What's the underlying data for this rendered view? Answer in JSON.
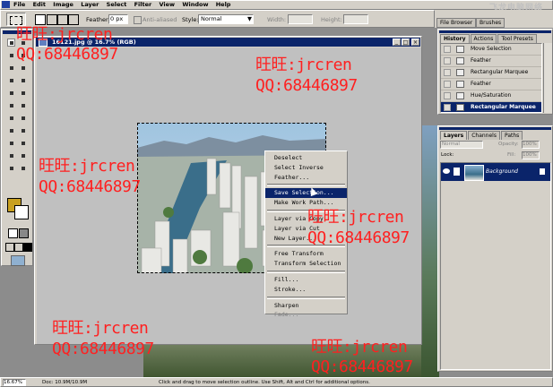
{
  "app": {
    "menu": [
      "File",
      "Edit",
      "Image",
      "Layer",
      "Select",
      "Filter",
      "View",
      "Window",
      "Help"
    ],
    "window_controls": {
      "minimize": "_",
      "restore": "□",
      "close": "×"
    }
  },
  "options": {
    "feather_label": "Feather:",
    "feather_value": "0 px",
    "antialiased_label": "Anti-aliased",
    "style_label": "Style:",
    "style_value": "Normal",
    "width_label": "Width:",
    "height_label": "Height:"
  },
  "palette_well": {
    "file_browser": "File Browser",
    "brushes": "Brushes"
  },
  "watermark_top": "飞龙电脑网络",
  "document": {
    "title": "16121.jpg @ 16.7% (RGB)",
    "zoom": "16.67%",
    "status": "Doc: 10.9M/10.9M",
    "hint": "Click and drag to move selection outline. Use Shift, Alt and Ctrl for additional options."
  },
  "history": {
    "tabs": [
      "History",
      "Actions",
      "Tool Presets"
    ],
    "items": [
      "Move Selection",
      "Feather",
      "Rectangular Marquee",
      "Feather",
      "Hue/Saturation",
      "Rectangular Marquee"
    ]
  },
  "layers": {
    "tabs": [
      "Layers",
      "Channels",
      "Paths"
    ],
    "blend_mode": "Normal",
    "opacity_label": "Opacity:",
    "opacity_value": "100%",
    "lock_label": "Lock:",
    "fill_label": "Fill:",
    "fill_value": "100%",
    "layer_name": "Background"
  },
  "context_menu": {
    "items": [
      "Deselect",
      "Select Inverse",
      "Feather...",
      "Save Selection...",
      "Make Work Path...",
      "Layer via Copy",
      "Layer via Cut",
      "New Layer...",
      "Free Transform",
      "Transform Selection",
      "Fill...",
      "Stroke...",
      "Sharpen",
      "Fade..."
    ]
  },
  "watermarks": {
    "line1": "旺旺:jrcren",
    "line2": "QQ:68446897"
  },
  "colors": {
    "titlebar": "#0a246a",
    "chrome": "#d4d0c8",
    "watermark": "#ff2020",
    "selection": "#0a246a",
    "foreground": "#c8a020"
  }
}
